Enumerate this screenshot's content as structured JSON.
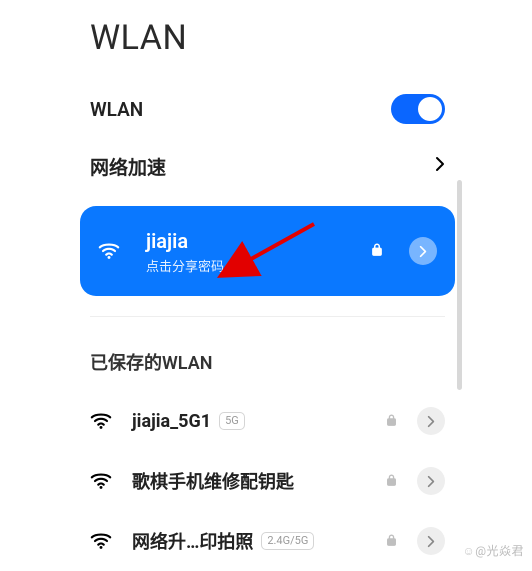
{
  "page_title": "WLAN",
  "wlan_toggle": {
    "label": "WLAN",
    "on": true
  },
  "accelerate": {
    "label": "网络加速"
  },
  "connected": {
    "name": "jiajia",
    "hint": "点击分享密码",
    "secured": true
  },
  "saved_section": {
    "title": "已保存的WLAN"
  },
  "saved_networks": [
    {
      "name": "jiajia_5G1",
      "badge": "5G",
      "secured": true
    },
    {
      "name": "歌棋手机维修配钥匙",
      "badge": null,
      "secured": true
    },
    {
      "name": "网络升…印拍照",
      "badge": "2.4G/5G",
      "secured": true
    }
  ],
  "watermark": "@光焱君",
  "colors": {
    "accent": "#0a78ff"
  }
}
